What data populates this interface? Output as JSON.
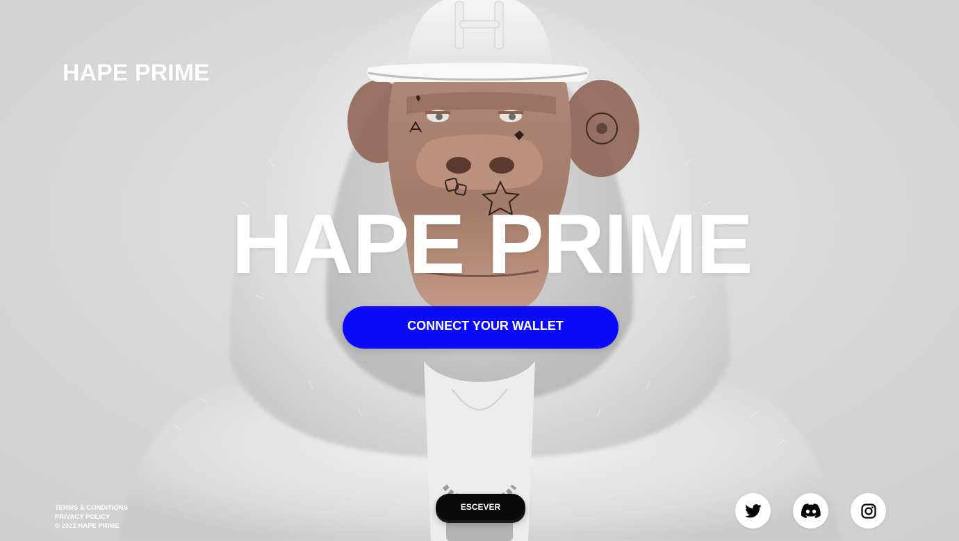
{
  "brand": {
    "logo_text": "HAPE PRIME"
  },
  "hero": {
    "title": "HAPE PRIME",
    "connect_label": "CONNECT YOUR WALLET"
  },
  "bottom": {
    "escever_label": "ESCEVER"
  },
  "footer": {
    "terms": "TERMS & CONDITIONS",
    "privacy": "PRIVACY POLICY",
    "copyright": "© 2022 HAPE PRIME"
  },
  "social": {
    "items": [
      {
        "name": "twitter",
        "icon": "twitter-icon"
      },
      {
        "name": "discord",
        "icon": "discord-icon"
      },
      {
        "name": "instagram",
        "icon": "instagram-icon"
      }
    ]
  },
  "colors": {
    "background": "#d9d9d9",
    "accent": "#0b0bf9",
    "dark_button": "#0a0a0a",
    "text": "#ffffff"
  }
}
